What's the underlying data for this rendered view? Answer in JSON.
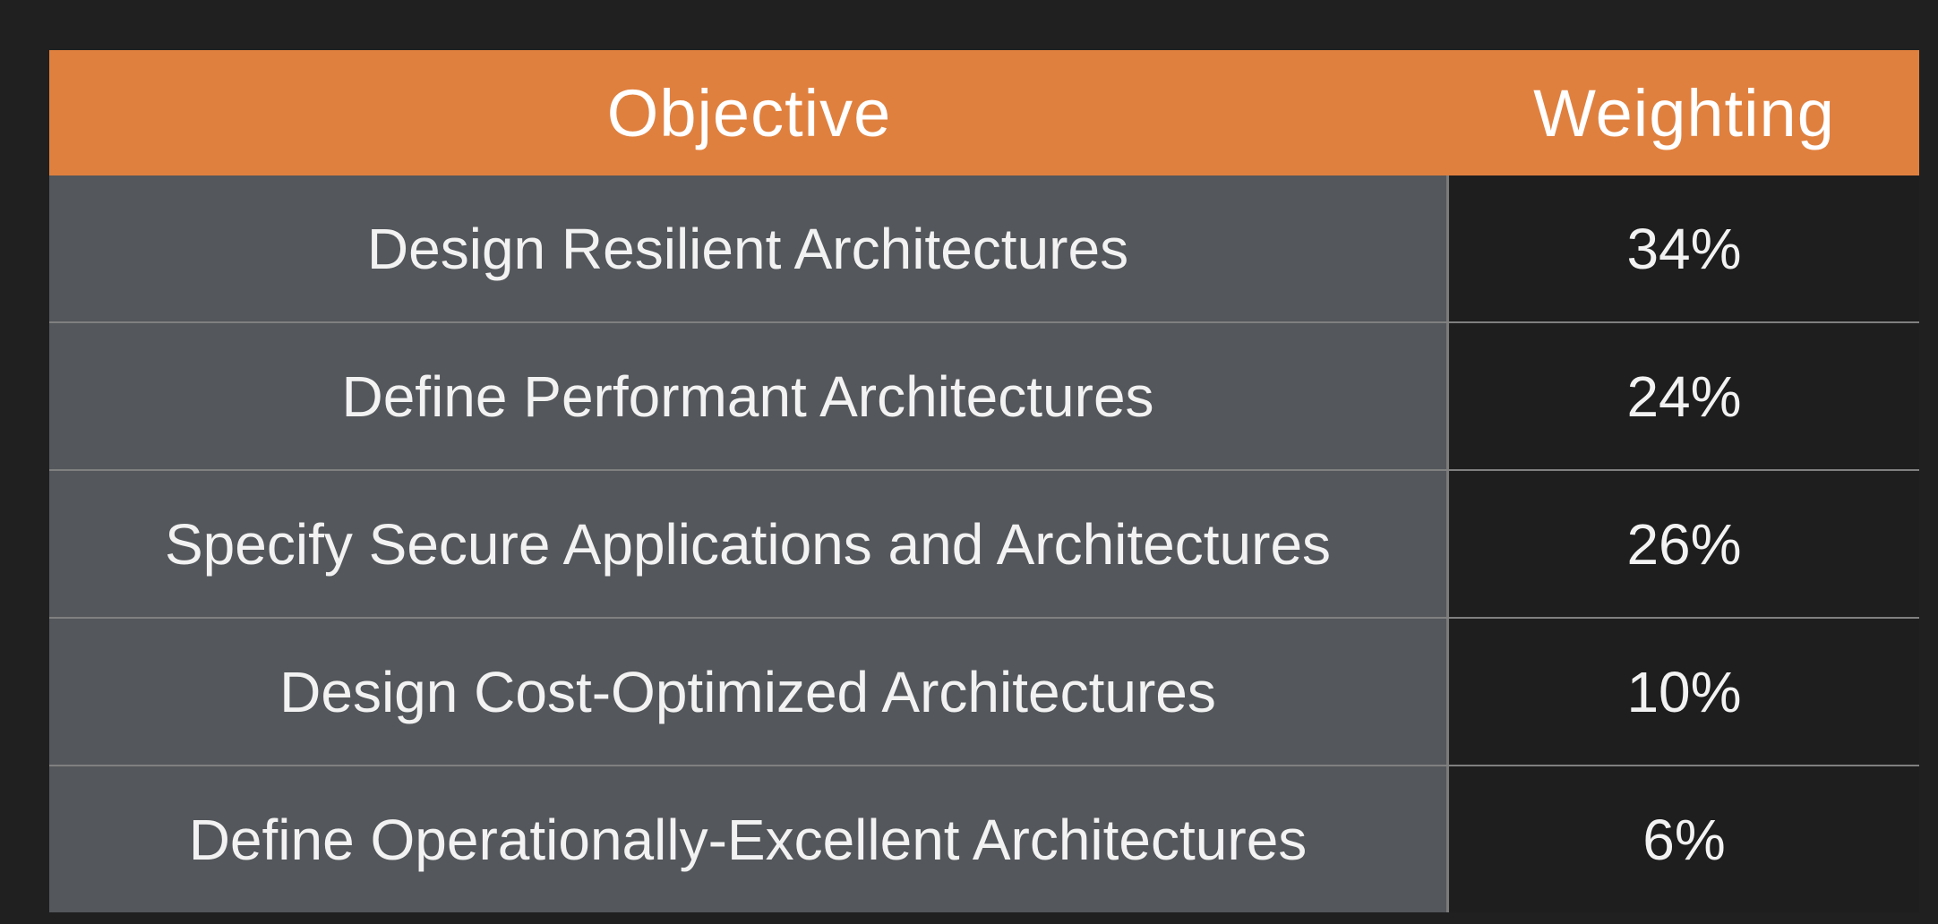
{
  "table": {
    "headers": {
      "objective": "Objective",
      "weighting": "Weighting"
    },
    "rows": [
      {
        "objective": "Design Resilient Architectures",
        "weighting": "34%"
      },
      {
        "objective": "Define Performant Architectures",
        "weighting": "24%"
      },
      {
        "objective": "Specify Secure Applications and Architectures",
        "weighting": "26%"
      },
      {
        "objective": "Design Cost-Optimized Architectures",
        "weighting": "10%"
      },
      {
        "objective": "Define Operationally-Excellent Architectures",
        "weighting": "6%"
      }
    ]
  },
  "colors": {
    "header_bg": "#e0803f",
    "objective_cell_bg": "#54575b",
    "weighting_cell_bg": "#1e1e1e",
    "page_bg": "#202020"
  }
}
